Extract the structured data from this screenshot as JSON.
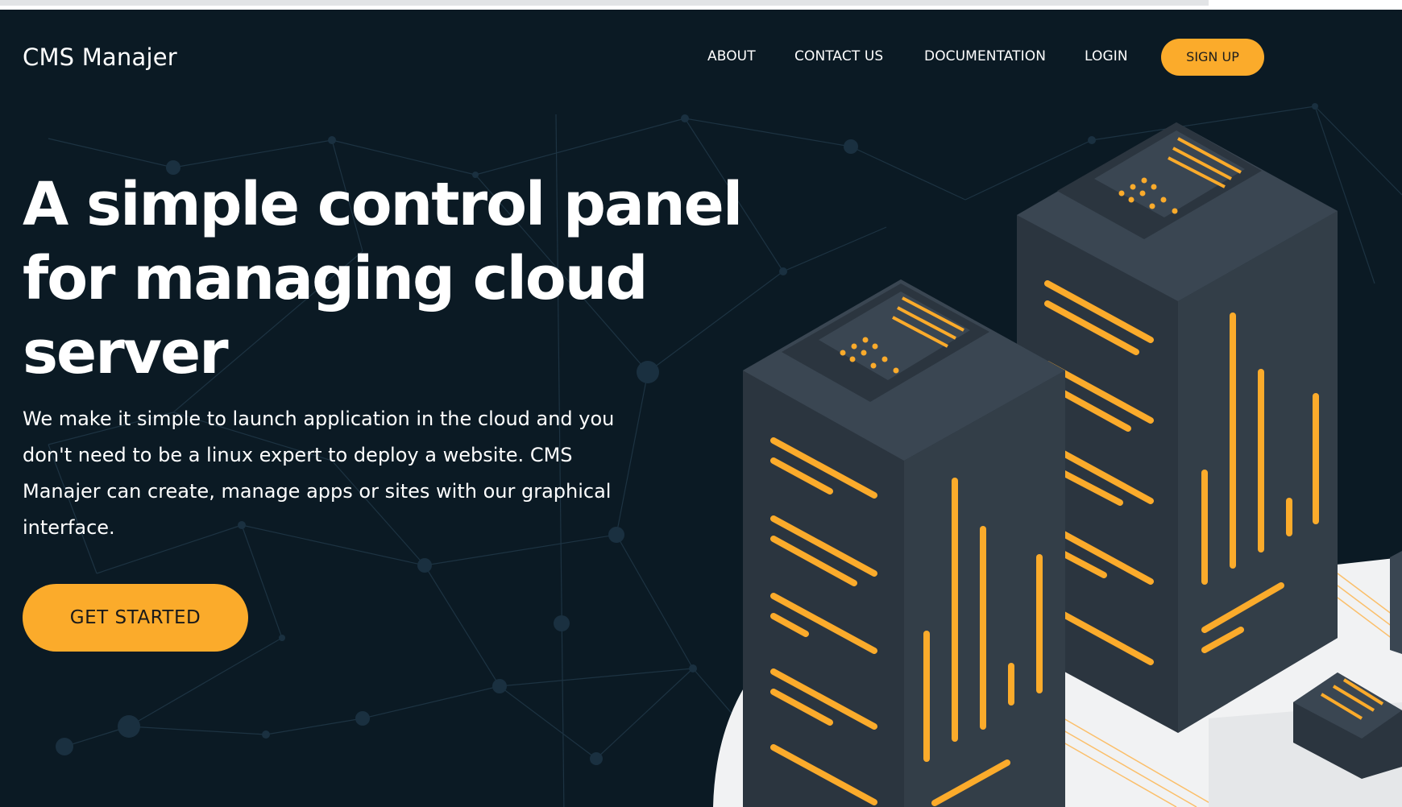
{
  "brand": {
    "name": "CMS Manajer"
  },
  "nav": {
    "about": "ABOUT",
    "contact": "CONTACT US",
    "documentation": "DOCUMENTATION",
    "login": "LOGIN",
    "signup": "SIGN UP"
  },
  "hero": {
    "headline": "A simple control panel for managing cloud server",
    "description": "We make it simple to launch application in the cloud and you don't need to be a linux expert to deploy a website. CMS Manajer can create, manage apps or sites with our graphical interface.",
    "cta": "GET STARTED"
  },
  "colors": {
    "background": "#0b1a24",
    "accent": "#fbab2b",
    "server_body": "#3a4652",
    "server_dark": "#2b353f",
    "platform": "#f1f2f3"
  }
}
